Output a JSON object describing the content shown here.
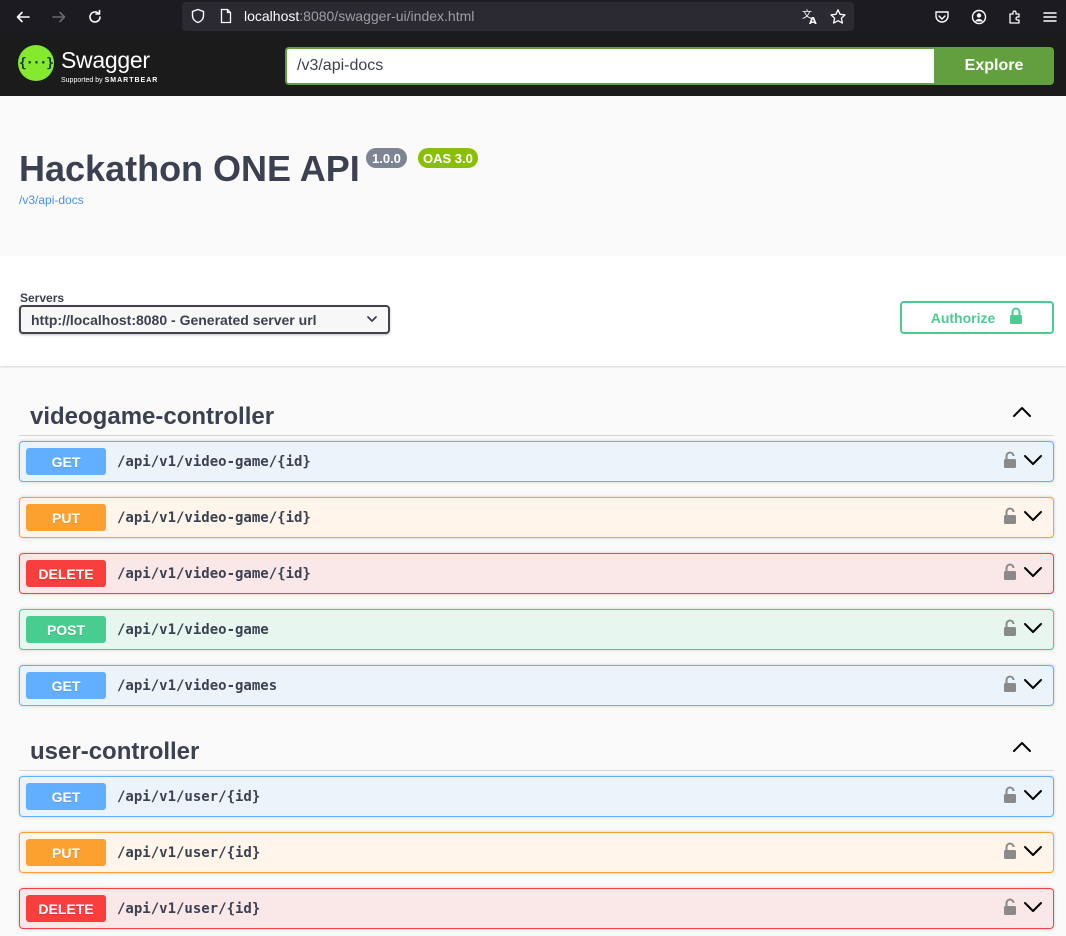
{
  "browser": {
    "url_host": "localhost",
    "url_rest": ":8080/swagger-ui/index.html"
  },
  "topbar": {
    "logo_text": "Swagger",
    "logo_mark": "{···}",
    "logo_sub_prefix": "Supported by",
    "logo_sub_brand": "SMARTBEAR",
    "explore_value": "/v3/api-docs",
    "explore_button": "Explore"
  },
  "info": {
    "title": "Hackathon ONE API",
    "version": "1.0.0",
    "oas": "OAS 3.0",
    "url": "/v3/api-docs"
  },
  "scheme": {
    "servers_label": "Servers",
    "server_selected": "http://localhost:8080 - Generated server url",
    "authorize_label": "Authorize"
  },
  "tags": [
    {
      "name": "videogame-controller",
      "operations": [
        {
          "method": "GET",
          "path": "/api/v1/video-game/{id}"
        },
        {
          "method": "PUT",
          "path": "/api/v1/video-game/{id}"
        },
        {
          "method": "DELETE",
          "path": "/api/v1/video-game/{id}"
        },
        {
          "method": "POST",
          "path": "/api/v1/video-game"
        },
        {
          "method": "GET",
          "path": "/api/v1/video-games"
        }
      ]
    },
    {
      "name": "user-controller",
      "operations": [
        {
          "method": "GET",
          "path": "/api/v1/user/{id}"
        },
        {
          "method": "PUT",
          "path": "/api/v1/user/{id}"
        },
        {
          "method": "DELETE",
          "path": "/api/v1/user/{id}"
        }
      ]
    }
  ],
  "colors": {
    "get": "#61affe",
    "put": "#fca130",
    "delete": "#f93e3e",
    "post": "#49cc90",
    "swagger_green": "#85ea2d",
    "explore_green": "#62a03f"
  }
}
